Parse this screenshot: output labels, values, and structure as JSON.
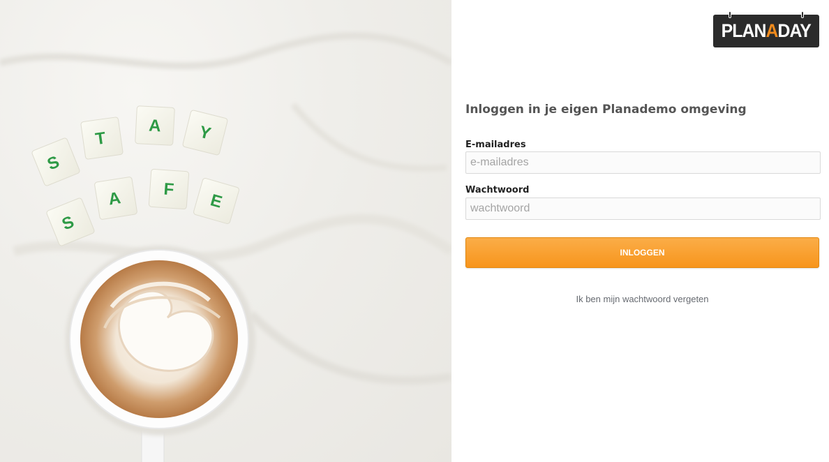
{
  "brand": {
    "logo_prefix": "PLAN",
    "logo_accent": "A",
    "logo_suffix": "DAY",
    "accent_color": "#f08a1c",
    "logo_background": "#2b2b2b"
  },
  "hero": {
    "tiles_top": [
      "S",
      "T",
      "A",
      "Y"
    ],
    "tiles_bottom": [
      "S",
      "A",
      "F",
      "E"
    ],
    "tile_letter_color": "#2e9a46",
    "icon": "coffee-cup"
  },
  "login": {
    "heading": "Inloggen in je eigen Planademo omgeving",
    "email_label": "E-mailadres",
    "email_placeholder": "e-mailadres",
    "email_value": "",
    "password_label": "Wachtwoord",
    "password_placeholder": "wachtwoord",
    "password_value": "",
    "submit_label": "INLOGGEN",
    "forgot_label": "Ik ben mijn wachtwoord vergeten",
    "button_color": "#f7951c"
  }
}
